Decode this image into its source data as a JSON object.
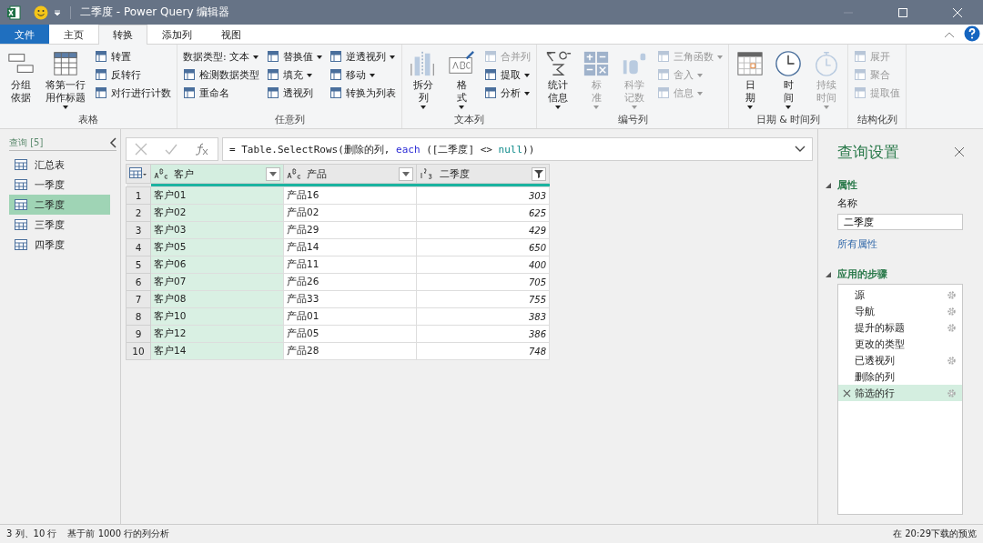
{
  "window": {
    "title": "二季度 - Power Query 编辑器"
  },
  "tabs": [
    {
      "label": "文件",
      "kind": "file",
      "selected": false
    },
    {
      "label": "主页",
      "kind": "tab",
      "selected": false
    },
    {
      "label": "转换",
      "kind": "tab",
      "selected": true
    },
    {
      "label": "添加列",
      "kind": "tab",
      "selected": false
    },
    {
      "label": "视图",
      "kind": "tab",
      "selected": false
    }
  ],
  "ribbon": {
    "groups": [
      {
        "label": "表格",
        "columns": [
          {
            "kind": "large",
            "lines": [
              "分组",
              "依据"
            ],
            "dropdown": false,
            "disabled": false
          },
          {
            "kind": "large",
            "lines": [
              "将第一行",
              "用作标题"
            ],
            "dropdown": true,
            "disabled": false
          },
          {
            "kind": "stack",
            "items": [
              {
                "label": "转置",
                "dropdown": false,
                "disabled": false
              },
              {
                "label": "反转行",
                "dropdown": false,
                "disabled": false
              },
              {
                "label": "对行进行计数",
                "dropdown": false,
                "disabled": false
              }
            ]
          }
        ]
      },
      {
        "label": "任意列",
        "columns": [
          {
            "kind": "stack",
            "items": [
              {
                "label": "数据类型: 文本",
                "dropdown": true,
                "disabled": false,
                "noicon": true
              },
              {
                "label": "检测数据类型",
                "dropdown": false,
                "disabled": false
              },
              {
                "label": "重命名",
                "dropdown": false,
                "disabled": false
              }
            ]
          },
          {
            "kind": "stack",
            "items": [
              {
                "label": "替换值",
                "dropdown": true,
                "disabled": false
              },
              {
                "label": "填充",
                "dropdown": true,
                "disabled": false
              },
              {
                "label": "透视列",
                "dropdown": false,
                "disabled": false
              }
            ]
          },
          {
            "kind": "stack",
            "items": [
              {
                "label": "逆透视列",
                "dropdown": true,
                "disabled": false
              },
              {
                "label": "移动",
                "dropdown": true,
                "disabled": false
              },
              {
                "label": "转换为列表",
                "dropdown": false,
                "disabled": false
              }
            ]
          }
        ]
      },
      {
        "label": "文本列",
        "columns": [
          {
            "kind": "large",
            "lines": [
              "拆分",
              "列"
            ],
            "dropdown": true,
            "disabled": false
          },
          {
            "kind": "large",
            "lines": [
              "格",
              "式"
            ],
            "dropdown": true,
            "disabled": false
          },
          {
            "kind": "stack",
            "items": [
              {
                "label": "合并列",
                "dropdown": false,
                "disabled": true
              },
              {
                "label": "提取",
                "dropdown": true,
                "disabled": false
              },
              {
                "label": "分析",
                "dropdown": true,
                "disabled": false
              }
            ]
          }
        ]
      },
      {
        "label": "编号列",
        "columns": [
          {
            "kind": "large",
            "lines": [
              "统计",
              "信息"
            ],
            "dropdown": true,
            "disabled": false
          },
          {
            "kind": "large",
            "lines": [
              "标",
              "准"
            ],
            "dropdown": true,
            "disabled": true
          },
          {
            "kind": "large",
            "lines": [
              "科学",
              "记数"
            ],
            "dropdown": true,
            "disabled": true
          },
          {
            "kind": "stack",
            "items": [
              {
                "label": "三角函数",
                "dropdown": true,
                "disabled": true
              },
              {
                "label": "舍入",
                "dropdown": true,
                "disabled": true
              },
              {
                "label": "信息",
                "dropdown": true,
                "disabled": true
              }
            ]
          }
        ]
      },
      {
        "label": "日期 & 时间列",
        "columns": [
          {
            "kind": "large",
            "lines": [
              "日",
              "期"
            ],
            "dropdown": true,
            "disabled": false
          },
          {
            "kind": "large",
            "lines": [
              "时",
              "间"
            ],
            "dropdown": true,
            "disabled": false
          },
          {
            "kind": "large",
            "lines": [
              "持续",
              "时间"
            ],
            "dropdown": true,
            "disabled": true
          }
        ]
      },
      {
        "label": "结构化列",
        "columns": [
          {
            "kind": "stack",
            "items": [
              {
                "label": "展开",
                "dropdown": false,
                "disabled": true
              },
              {
                "label": "聚合",
                "dropdown": false,
                "disabled": true
              },
              {
                "label": "提取值",
                "dropdown": false,
                "disabled": true
              }
            ]
          }
        ]
      }
    ]
  },
  "queries": {
    "title": "查询 [5]",
    "items": [
      {
        "label": "汇总表",
        "selected": false
      },
      {
        "label": "一季度",
        "selected": false
      },
      {
        "label": "二季度",
        "selected": true
      },
      {
        "label": "三季度",
        "selected": false
      },
      {
        "label": "四季度",
        "selected": false
      }
    ]
  },
  "formula_bar": {
    "formula": [
      {
        "text": "= Table.SelectRows(删除的列, ",
        "kind": "plain"
      },
      {
        "text": "each",
        "kind": "keyword"
      },
      {
        "text": " ([二季度] <> ",
        "kind": "plain"
      },
      {
        "text": "null",
        "kind": "literal"
      },
      {
        "text": "))",
        "kind": "plain"
      }
    ]
  },
  "table": {
    "columns": [
      {
        "name": "客户",
        "kind": "text",
        "selected": true,
        "filtered": false
      },
      {
        "name": "产品",
        "kind": "text",
        "selected": false,
        "filtered": false
      },
      {
        "name": "二季度",
        "kind": "number",
        "selected": false,
        "filtered": true
      }
    ],
    "rows": [
      {
        "number": "1",
        "cells": [
          "客户01",
          "产品16",
          "303"
        ]
      },
      {
        "number": "2",
        "cells": [
          "客户02",
          "产品02",
          "625"
        ]
      },
      {
        "number": "3",
        "cells": [
          "客户03",
          "产品29",
          "429"
        ]
      },
      {
        "number": "4",
        "cells": [
          "客户05",
          "产品14",
          "650"
        ]
      },
      {
        "number": "5",
        "cells": [
          "客户06",
          "产品11",
          "400"
        ]
      },
      {
        "number": "6",
        "cells": [
          "客户07",
          "产品26",
          "705"
        ]
      },
      {
        "number": "7",
        "cells": [
          "客户08",
          "产品33",
          "755"
        ]
      },
      {
        "number": "8",
        "cells": [
          "客户10",
          "产品01",
          "383"
        ]
      },
      {
        "number": "9",
        "cells": [
          "客户12",
          "产品05",
          "386"
        ]
      },
      {
        "number": "10",
        "cells": [
          "客户14",
          "产品28",
          "748"
        ]
      }
    ]
  },
  "query_settings": {
    "title": "查询设置",
    "properties_heading": "属性",
    "name_label": "名称",
    "name_value": "二季度",
    "all_properties_link": "所有属性",
    "steps_heading": "应用的步骤",
    "steps": [
      {
        "label": "源",
        "settings": true,
        "selected": false
      },
      {
        "label": "导航",
        "settings": true,
        "selected": false
      },
      {
        "label": "提升的标题",
        "settings": true,
        "selected": false
      },
      {
        "label": "更改的类型",
        "settings": false,
        "selected": false
      },
      {
        "label": "已透视列",
        "settings": true,
        "selected": false
      },
      {
        "label": "删除的列",
        "settings": false,
        "selected": false
      },
      {
        "label": "筛选的行",
        "settings": true,
        "selected": true
      }
    ]
  },
  "status_bar": {
    "left": "3 列、10 行",
    "middle": "基于前 1000 行的列分析",
    "right": "在 20:29下载的预览"
  }
}
